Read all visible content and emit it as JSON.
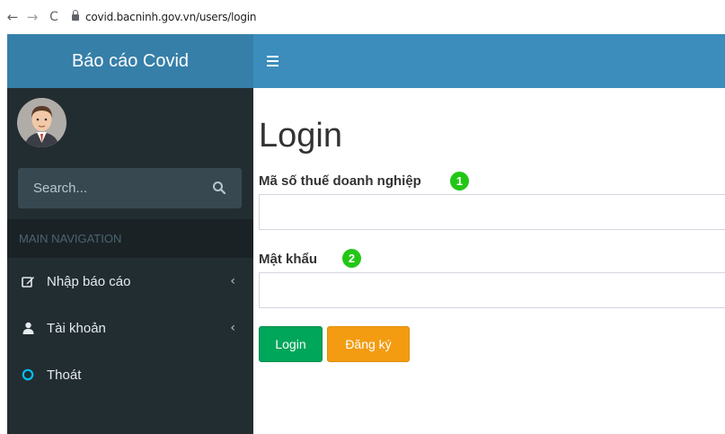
{
  "browser": {
    "url": "covid.bacninh.gov.vn/users/login",
    "back_icon": "arrow-left-icon",
    "forward_icon": "arrow-right-icon",
    "reload_icon": "reload-icon"
  },
  "sidebar": {
    "brand": "Báo cáo Covid",
    "search_placeholder": "Search...",
    "nav_header": "MAIN NAVIGATION",
    "items": [
      {
        "label": "Nhập báo cáo",
        "icon": "edit-icon",
        "has_chevron": true
      },
      {
        "label": "Tài khoản",
        "icon": "user-icon",
        "has_chevron": true
      },
      {
        "label": "Thoát",
        "icon": "circle-icon",
        "has_chevron": false
      }
    ],
    "chevron": "‹"
  },
  "form": {
    "title": "Login",
    "tax_label": "Mã số thuế doanh nghiệp",
    "tax_value": "",
    "tax_badge": "1",
    "password_label": "Mật khẩu",
    "password_value": "",
    "password_badge": "2",
    "login_button": "Login",
    "register_button": "Đăng ký"
  },
  "colors": {
    "brand_bg": "#367fa9",
    "topbar_bg": "#3c8dbc",
    "sidebar_bg": "#222d32",
    "login_btn": "#00a65a",
    "register_btn": "#f39c12",
    "badge": "#22c716"
  }
}
